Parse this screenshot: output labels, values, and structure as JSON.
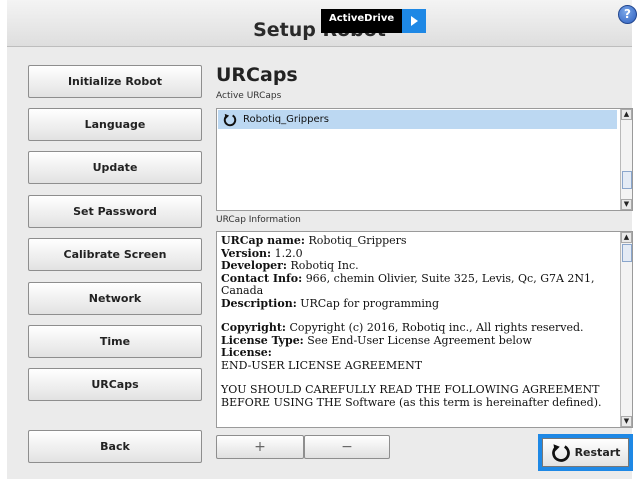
{
  "header": {
    "title": "Setup Robot",
    "help_icon": "?",
    "activedrive_label": "ActiveDrive"
  },
  "nav": {
    "items": [
      {
        "label": "Initialize Robot"
      },
      {
        "label": "Language"
      },
      {
        "label": "Update"
      },
      {
        "label": "Set Password"
      },
      {
        "label": "Calibrate Screen"
      },
      {
        "label": "Network"
      },
      {
        "label": "Time"
      },
      {
        "label": "URCaps"
      }
    ],
    "back_label": "Back"
  },
  "main": {
    "title": "URCaps",
    "active_label": "Active URCaps",
    "urcaps": [
      {
        "name": "Robotiq_Grippers",
        "icon": "refresh-icon"
      }
    ],
    "info_label": "URCap Information",
    "info": {
      "name_key": "URCap name:",
      "name_val": "Robotiq_Grippers",
      "version_key": "Version:",
      "version_val": "1.2.0",
      "developer_key": "Developer:",
      "developer_val": "Robotiq Inc.",
      "contact_key": "Contact Info:",
      "contact_val": "966, chemin Olivier, Suite 325, Levis, Qc, G7A 2N1, Canada",
      "description_key": "Description:",
      "description_val": "URCap for programming",
      "copyright_key": "Copyright:",
      "copyright_val": "Copyright (c) 2016, Robotiq inc., All rights reserved.",
      "license_type_key": "License Type:",
      "license_type_val": "See End-User License Agreement below",
      "license_key": "License:",
      "license_line1": "END-USER LICENSE AGREEMENT",
      "license_line2": "YOU SHOULD CAREFULLY READ THE FOLLOWING AGREEMENT",
      "license_line3": "BEFORE USING THE Software (as this term is hereinafter defined)."
    },
    "add_label": "+",
    "remove_label": "−",
    "restart_label": "Restart"
  },
  "colors": {
    "accent": "#1e88e5",
    "selection": "#bcd8f2",
    "panel": "#ebebeb"
  }
}
